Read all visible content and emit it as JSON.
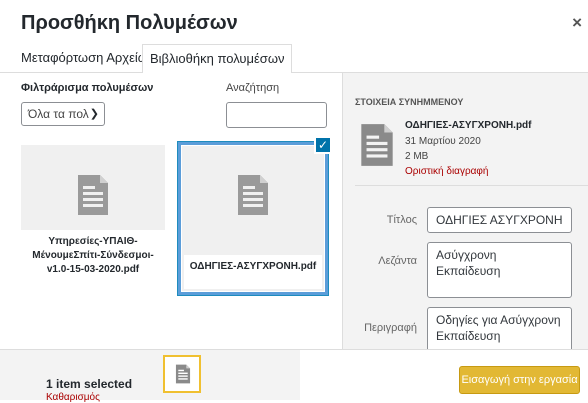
{
  "modal": {
    "title": "Προσθήκη Πολυμέσων",
    "close_label": "×"
  },
  "tabs": [
    {
      "label": "Μεταφόρτωση Αρχείων",
      "active": false
    },
    {
      "label": "Βιβλιοθήκη πολυμέσων",
      "active": true
    }
  ],
  "toolbar": {
    "filter_label": "Φιλτράρισμα πολυμέσων",
    "filter_value": "Όλα τα πολ",
    "search_label": "Αναζήτηση",
    "search_value": ""
  },
  "attachments": [
    {
      "caption": "Υπηρεσίες-ΥΠΑΙΘ-ΜένουμεΣπίτι-Σύνδεσμοι-v1.0-15-03-2020.pdf",
      "selected": false,
      "icon": "document-icon"
    },
    {
      "caption": "ΟΔΗΓΙΕΣ-ΑΣΥΓΧΡΟΝΗ.pdf",
      "selected": true,
      "icon": "document-icon"
    }
  ],
  "details": {
    "heading": "ΣΤΟΙΧΕΙΑ ΣΥΝΗΜΜΕΝΟΥ",
    "filename": "ΟΔΗΓΙΕΣ-ΑΣΥΓΧΡΟΝΗ.pdf",
    "date": "31 Μαρτίου 2020",
    "size": "2 MB",
    "delete_label": "Οριστική διαγραφή",
    "fields": {
      "title_label": "Τίτλος",
      "title_value": "ΟΔΗΓΙΕΣ ΑΣΥΓΧΡΟΝΗ",
      "caption_label": "Λεζάντα",
      "caption_value": "Ασύγχρονη Εκπαίδευση",
      "description_label": "Περιγραφή",
      "description_value": "Οδηγίες για Ασύγχρονη Εκπαίδευση"
    }
  },
  "footer": {
    "selection_count": "1 item selected",
    "clear_label": "Καθαρισμός",
    "insert_button": "Εισαγωγή στην εργασία"
  },
  "colors": {
    "accent": "#0073aa",
    "insert_button": "#e2b834",
    "delete_link": "#a00000"
  }
}
